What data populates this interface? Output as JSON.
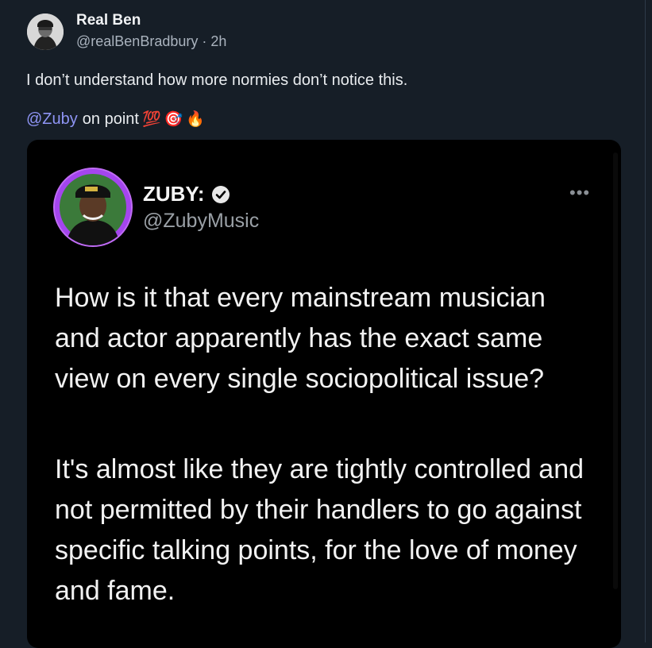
{
  "post": {
    "author_name": "Real Ben",
    "author_handle": "@realBenBradbury",
    "timestamp": "2h",
    "meta_separator": "·",
    "text_line1": "I don’t understand how more normies don’t notice this.",
    "mention": "@Zuby",
    "text_line2": "on point",
    "emojis": [
      "💯",
      "🎯",
      "🔥"
    ]
  },
  "embedded_tweet": {
    "name": "ZUBY:",
    "handle": "@ZubyMusic",
    "verified": true,
    "paragraph1": "How is it that every mainstream musician and actor apparently has the exact same view on every single sociopolitical issue?",
    "paragraph2": "It's almost like they are tightly controlled and not permitted by their handlers to go against specific talking points, for the love of money and fame."
  },
  "colors": {
    "background": "#161e27",
    "mention": "#8f95f5",
    "embed_background": "#000000",
    "avatar_ring": "#9b3fe8"
  },
  "icons": [
    "avatar",
    "verified-badge-icon",
    "more-options-icon"
  ]
}
